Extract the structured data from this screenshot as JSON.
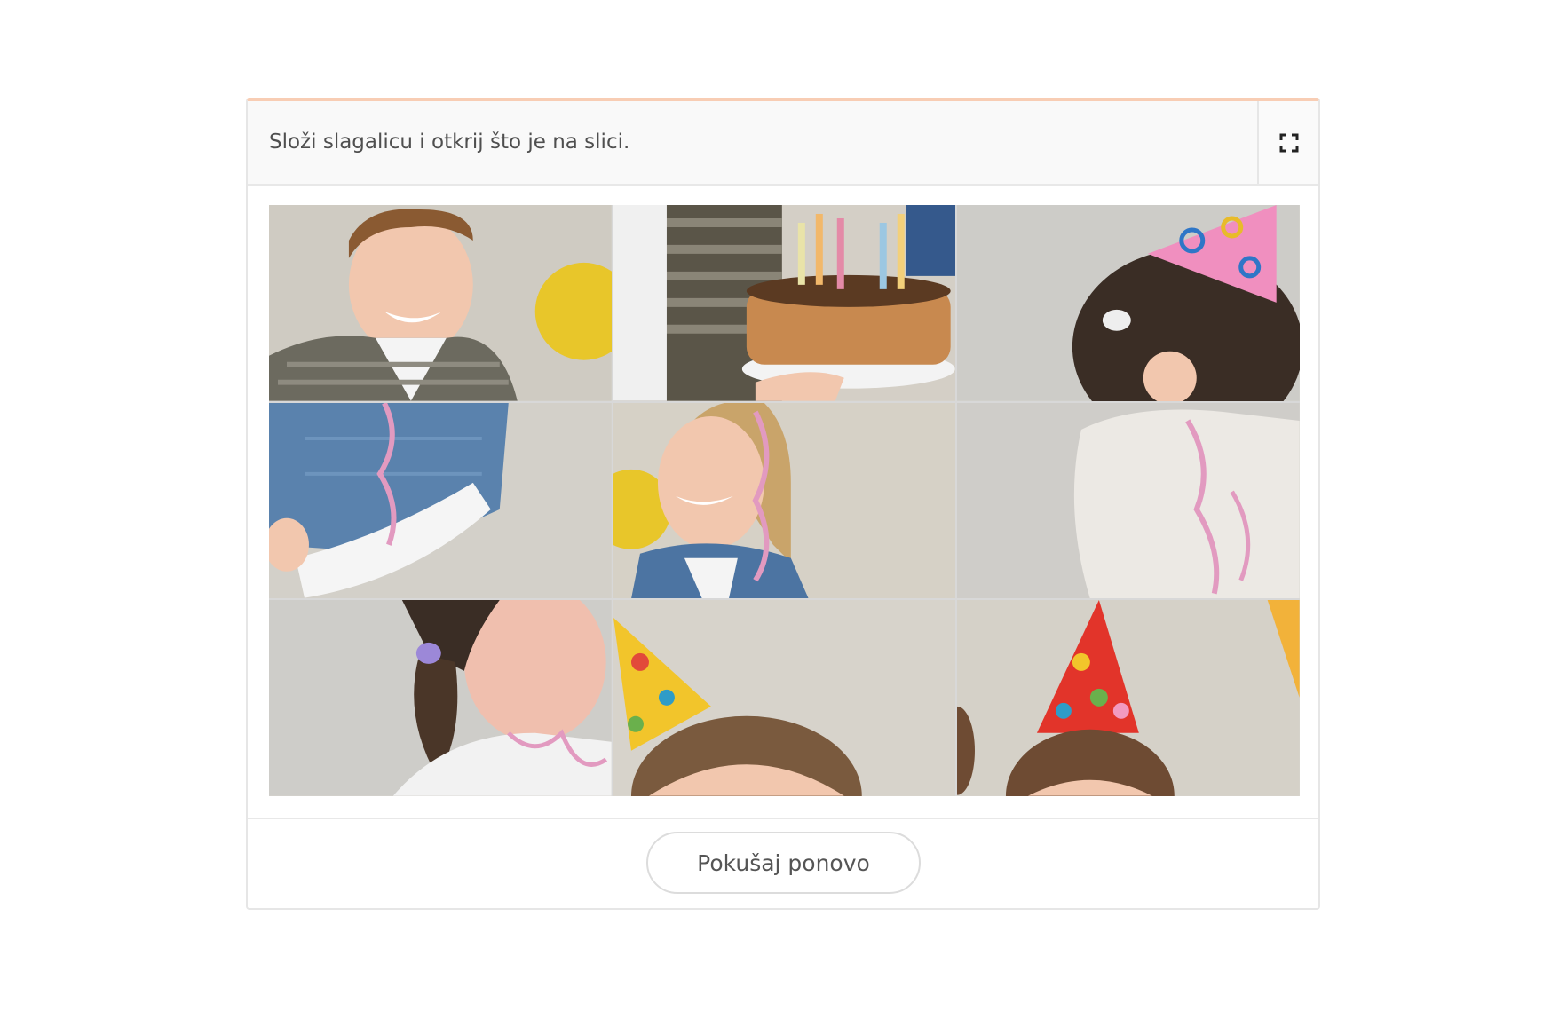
{
  "task": {
    "instruction": "Složi slagalicu i otkrij što je na slici."
  },
  "toolbar": {
    "fullscreen_icon": "fullscreen-icon"
  },
  "puzzle": {
    "rows": 3,
    "columns": 3,
    "tiles": [
      {
        "position": 1,
        "depicts": "boy-smiling-tile"
      },
      {
        "position": 2,
        "depicts": "birthday-cake-tile"
      },
      {
        "position": 3,
        "depicts": "girl-pink-party-hat-tile"
      },
      {
        "position": 4,
        "depicts": "denim-vest-arm-tile"
      },
      {
        "position": 5,
        "depicts": "girl-smiling-tile"
      },
      {
        "position": 6,
        "depicts": "white-dress-ribbon-tile"
      },
      {
        "position": 7,
        "depicts": "girl-pigtail-tile"
      },
      {
        "position": 8,
        "depicts": "yellow-party-hat-tile"
      },
      {
        "position": 9,
        "depicts": "red-party-hat-tile"
      }
    ]
  },
  "footer": {
    "retry_label": "Pokušaj ponovo"
  },
  "colors": {
    "accent_border": "#f8cdb4",
    "header_bg": "#f9f9f9",
    "text": "#4f4f4f"
  }
}
